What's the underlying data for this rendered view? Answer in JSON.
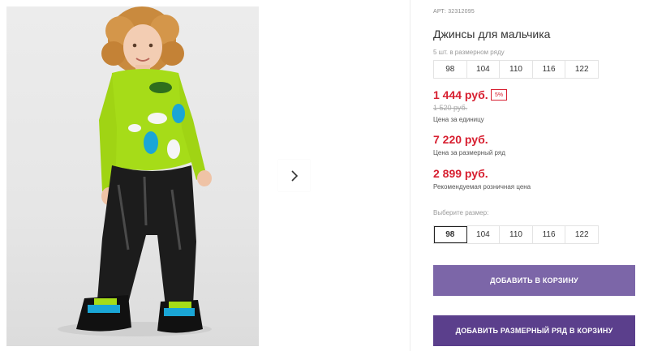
{
  "product": {
    "sku": "АРТ: 32312095",
    "title": "Джинсы для мальчика",
    "image_alt": "Мальчик в зелёном лонгсливе с динозаврами и чёрных джинсах"
  },
  "gallery": {
    "next_icon": "chevron-right-icon"
  },
  "row_sizes": {
    "hint": "5 шт. в размерном ряду",
    "items": [
      "98",
      "104",
      "110",
      "116",
      "122"
    ]
  },
  "pricing": {
    "unit_price": "1 444 руб.",
    "discount": "5%",
    "old_price": "1 520 руб.",
    "unit_caption": "Цена за единицу",
    "row_price": "7 220 руб.",
    "row_caption": "Цена за размерный ряд",
    "rrp": "2 899 руб.",
    "rrp_caption": "Рекомендуемая розничная цена"
  },
  "size_select": {
    "hint": "Выберите размер:",
    "items": [
      "98",
      "104",
      "110",
      "116",
      "122"
    ],
    "selected": "98"
  },
  "actions": {
    "add_to_cart": "ДОБАВИТЬ В КОРЗИНУ",
    "add_row_to_cart": "ДОБАВИТЬ РАЗМЕРНЫЙ РЯД В КОРЗИНУ"
  },
  "colors": {
    "price_red": "#d71f30",
    "button_light": "#7c66a8",
    "button_dark": "#5b3f8c"
  }
}
